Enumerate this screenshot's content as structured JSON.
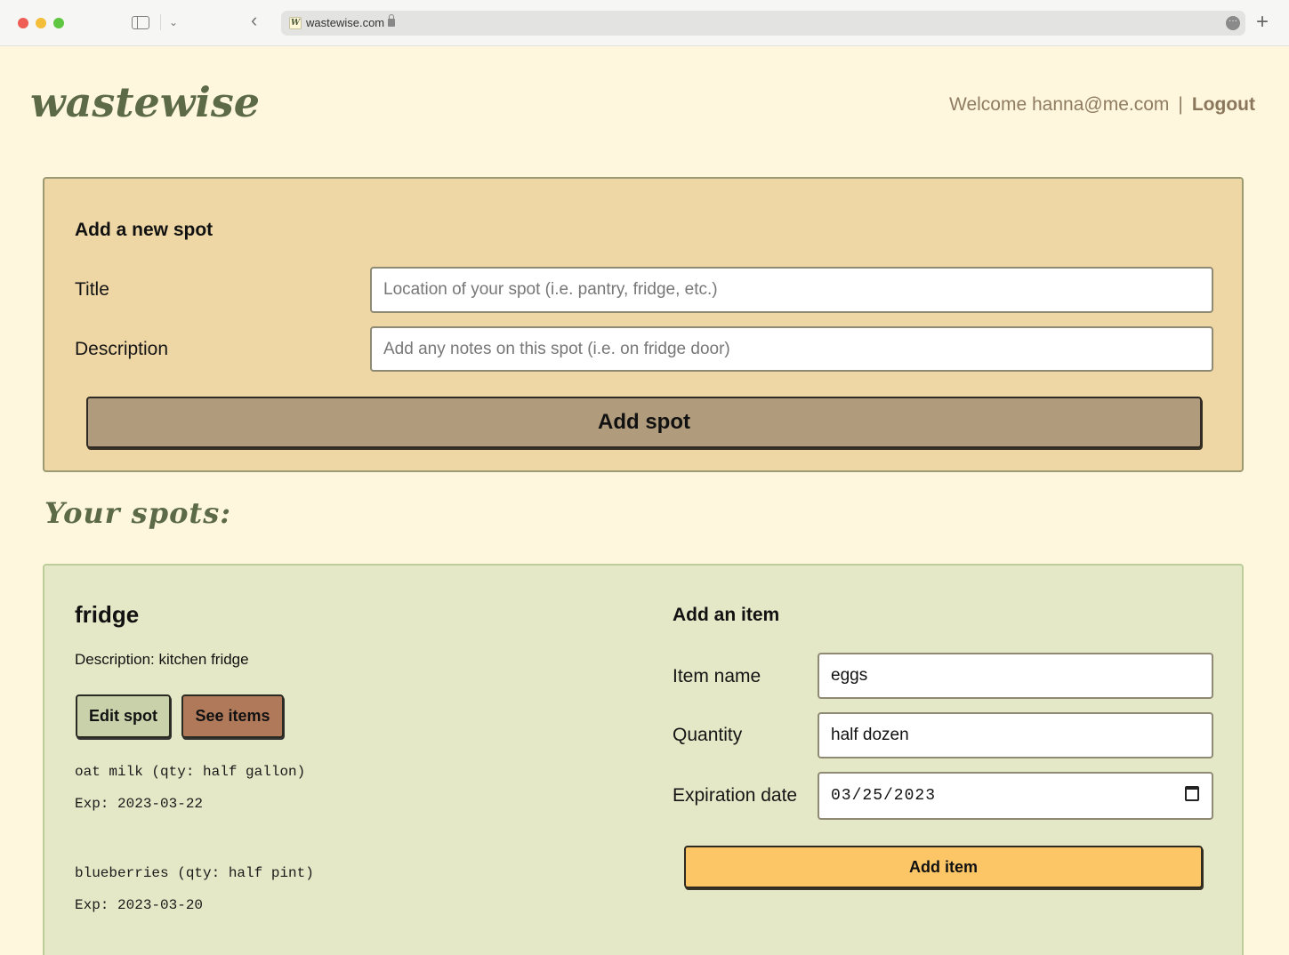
{
  "browser": {
    "url": "wastewise.com",
    "favicon": "W"
  },
  "header": {
    "logo": "wastewise",
    "welcome": "Welcome hanna@me.com",
    "separator": "|",
    "logout": "Logout"
  },
  "spot_form": {
    "heading": "Add a new spot",
    "title_label": "Title",
    "title_placeholder": "Location of your spot (i.e. pantry, fridge, etc.)",
    "description_label": "Description",
    "description_placeholder": "Add any notes on this spot (i.e. on fridge door)",
    "submit": "Add spot"
  },
  "spots_heading": "Your spots:",
  "spot": {
    "title": "fridge",
    "description": "Description: kitchen fridge",
    "edit_button": "Edit spot",
    "see_items_button": "See items",
    "items": [
      {
        "name_line": "oat milk (qty: half gallon)",
        "exp_line": "Exp: 2023-03-22"
      },
      {
        "name_line": "blueberries (qty: half pint)",
        "exp_line": "Exp: 2023-03-20"
      }
    ]
  },
  "item_form": {
    "heading": "Add an item",
    "name_label": "Item name",
    "name_value": "eggs",
    "quantity_label": "Quantity",
    "quantity_value": "half dozen",
    "expiration_label": "Expiration date",
    "expiration_value": "03/25/2023",
    "submit": "Add item"
  },
  "colors": {
    "page_bg": "#fef7de",
    "logo": "#5c6a47",
    "spot_form_bg": "#efd7a5",
    "spot_card_bg": "#e5e8c6",
    "add_spot_button": "#b19b7d",
    "edit_button": "#c8d1aa",
    "see_items_button": "#b07a5a",
    "add_item_button": "#fcc667"
  }
}
